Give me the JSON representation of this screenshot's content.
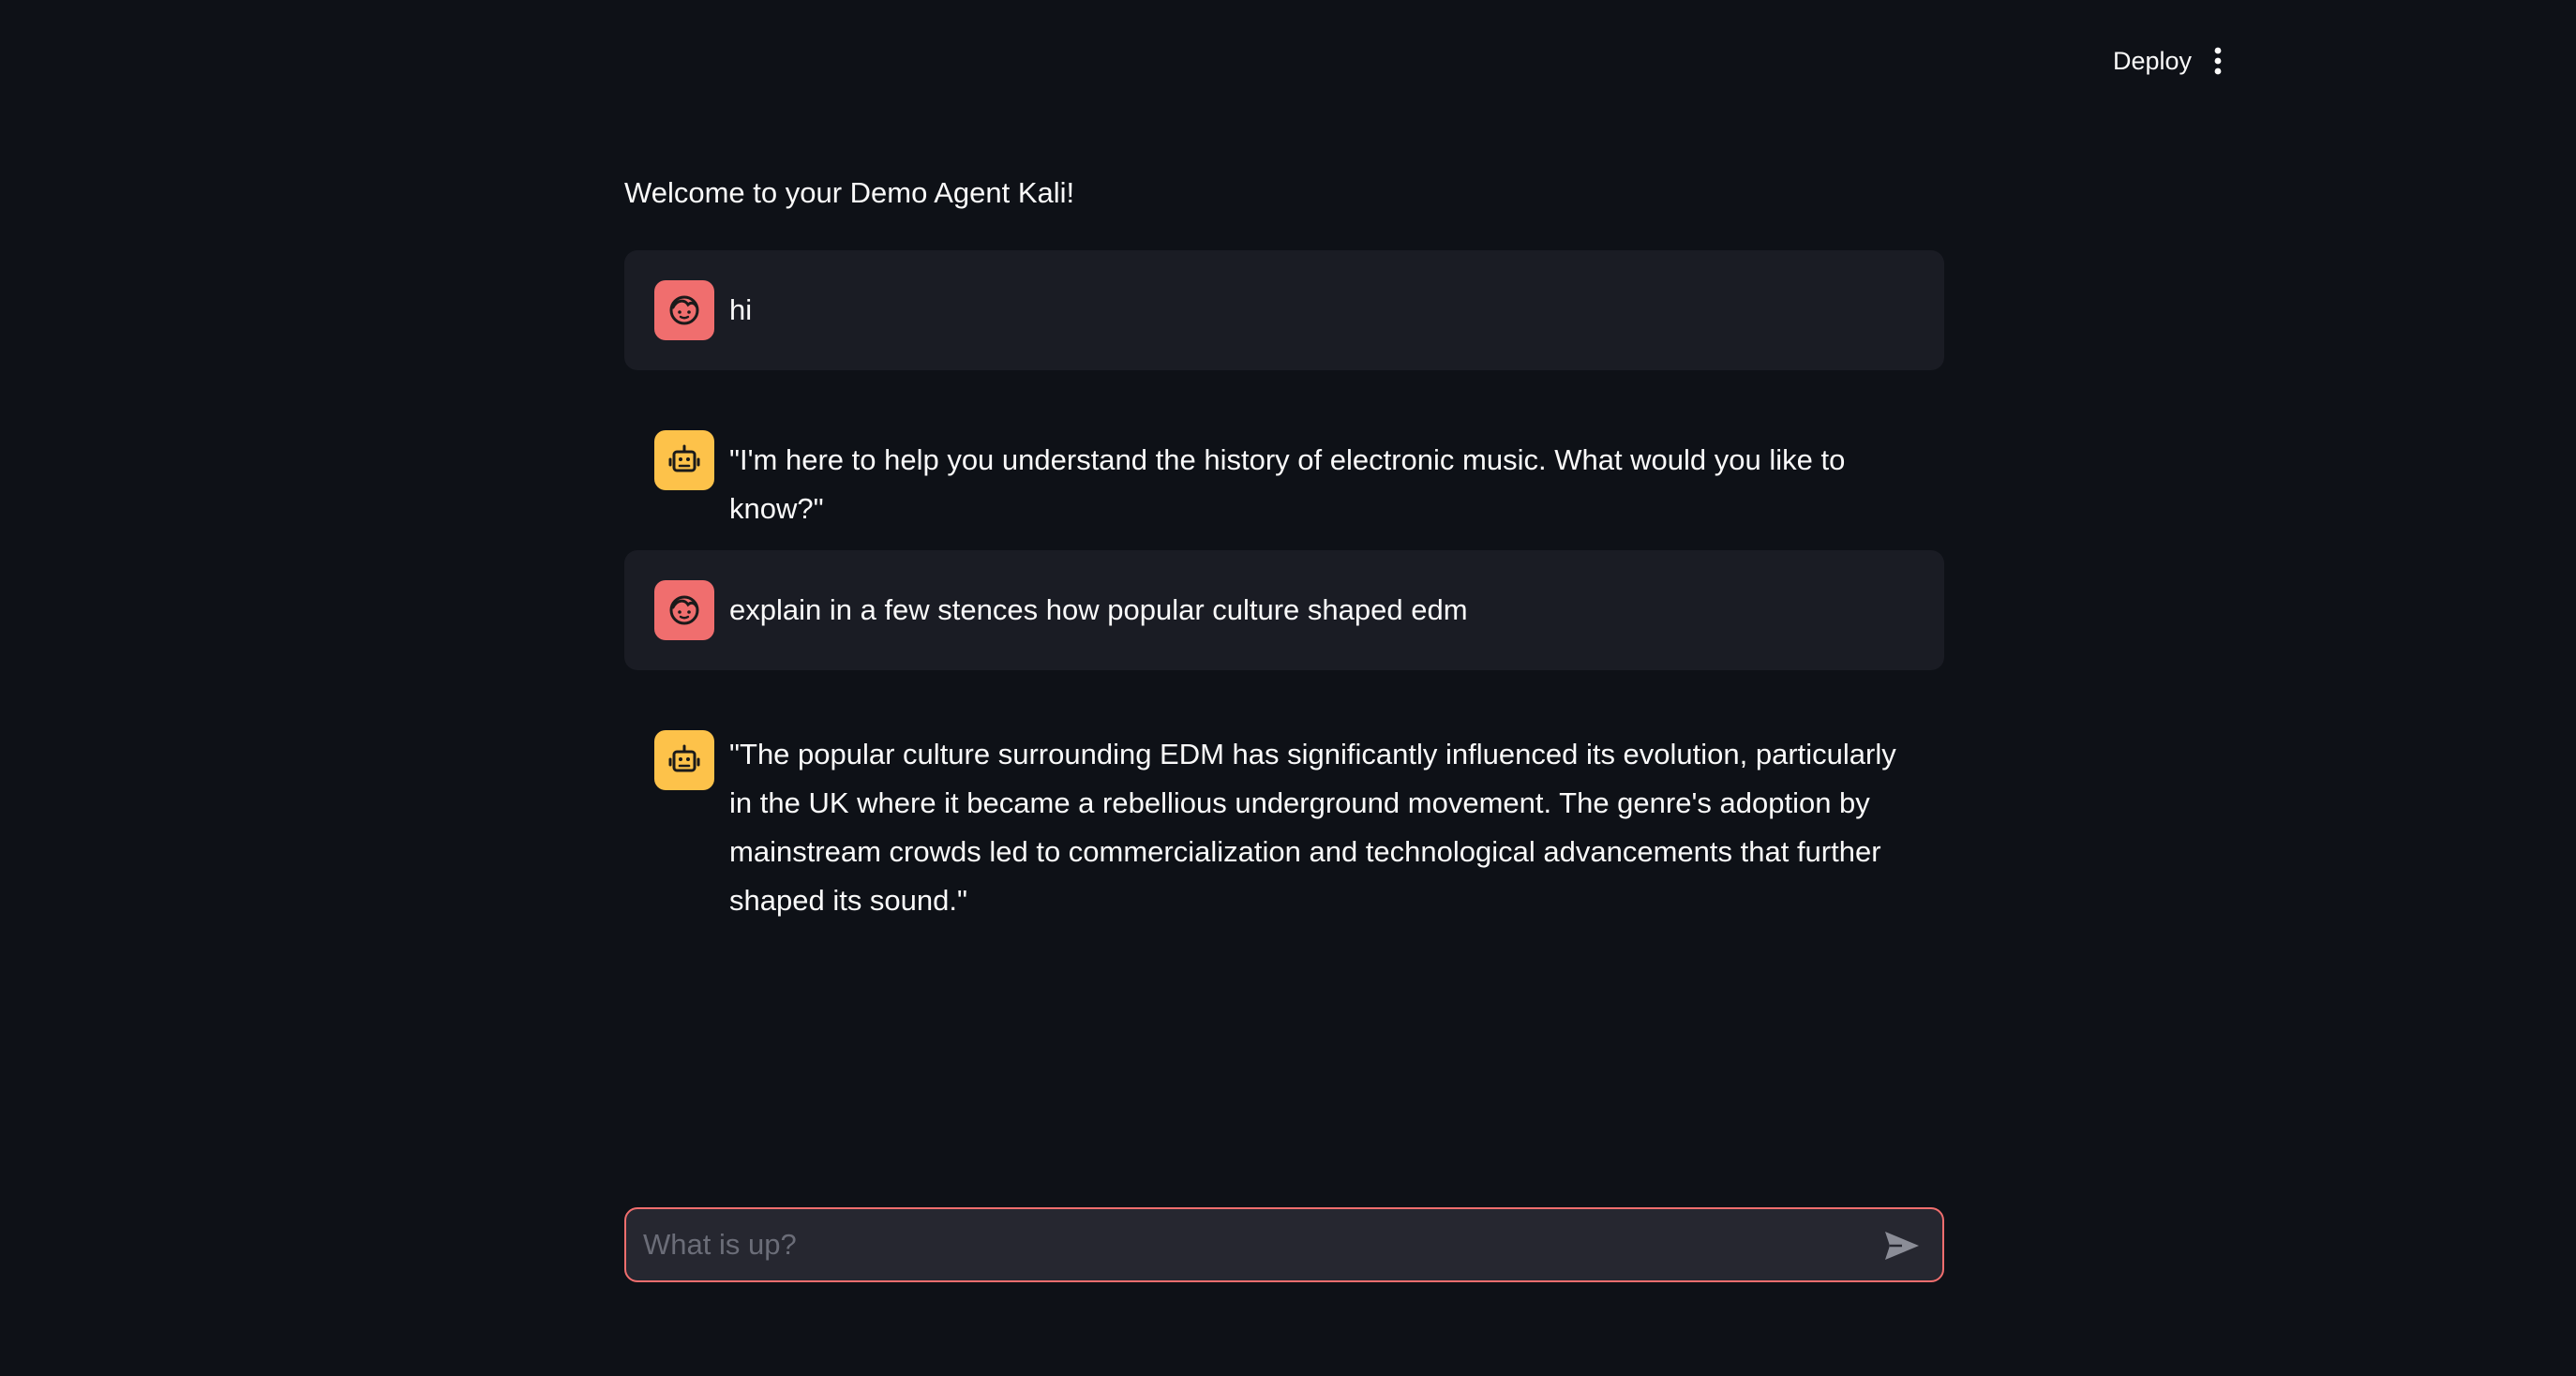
{
  "header": {
    "deploy_label": "Deploy",
    "menu_icon": "more-vertical-icon"
  },
  "main": {
    "welcome": "Welcome to your Demo Agent Kali!",
    "messages": [
      {
        "role": "user",
        "avatar_icon": "user-face-icon",
        "text": "hi"
      },
      {
        "role": "assistant",
        "avatar_icon": "robot-icon",
        "text": "\"I'm here to help you understand the history of electronic music. What would you like to know?\""
      },
      {
        "role": "user",
        "avatar_icon": "user-face-icon",
        "text": "explain in a few stences how popular culture shaped edm"
      },
      {
        "role": "assistant",
        "avatar_icon": "robot-icon",
        "text": "\"The popular culture surrounding EDM has significantly influenced its evolution, particularly in the UK where it became a rebellious underground movement. The genre's adoption by mainstream crowds led to commercialization and technological advancements that further shaped its sound.\""
      }
    ]
  },
  "chat_input": {
    "value": "",
    "placeholder": "What is up?",
    "send_icon": "send-icon"
  },
  "colors": {
    "background": "#0e1117",
    "user_message_bg": "#1a1c24",
    "user_avatar": "#f06e6e",
    "assistant_avatar": "#fdc24a",
    "input_border": "#f06e6e",
    "input_bg": "#262730"
  }
}
